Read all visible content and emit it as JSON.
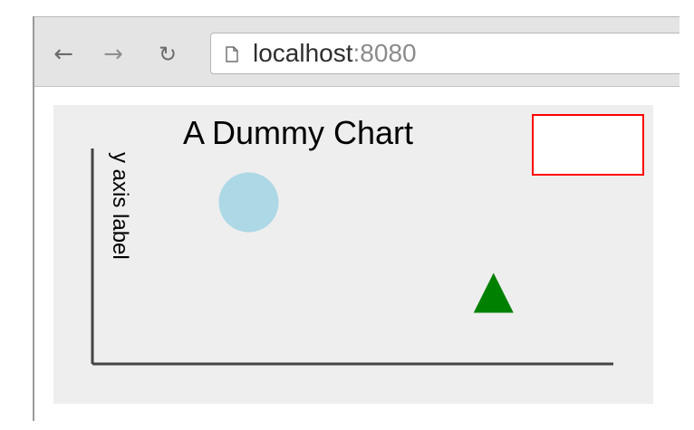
{
  "browser": {
    "address": {
      "host": "localhost",
      "port": ":8080"
    },
    "icons": {
      "back": "arrow-left-icon",
      "forward": "arrow-right-icon",
      "reload": "reload-icon",
      "page": "page-icon"
    }
  },
  "chart_data": {
    "type": "scatter",
    "title": "A Dummy Chart",
    "xlabel": "",
    "ylabel": "y axis label",
    "points": [
      {
        "shape": "circle",
        "x": 0.3,
        "y": 0.75,
        "color": "#add8e6"
      },
      {
        "shape": "triangle",
        "x": 0.77,
        "y": 0.33,
        "color": "#008000"
      }
    ],
    "xlim": [
      0,
      1
    ],
    "ylim": [
      0,
      1
    ],
    "legend": {
      "placement": "top-right",
      "items": [],
      "border_color": "#ff0000"
    },
    "axis_color": "#444444",
    "background_color": "#eeeeee"
  }
}
